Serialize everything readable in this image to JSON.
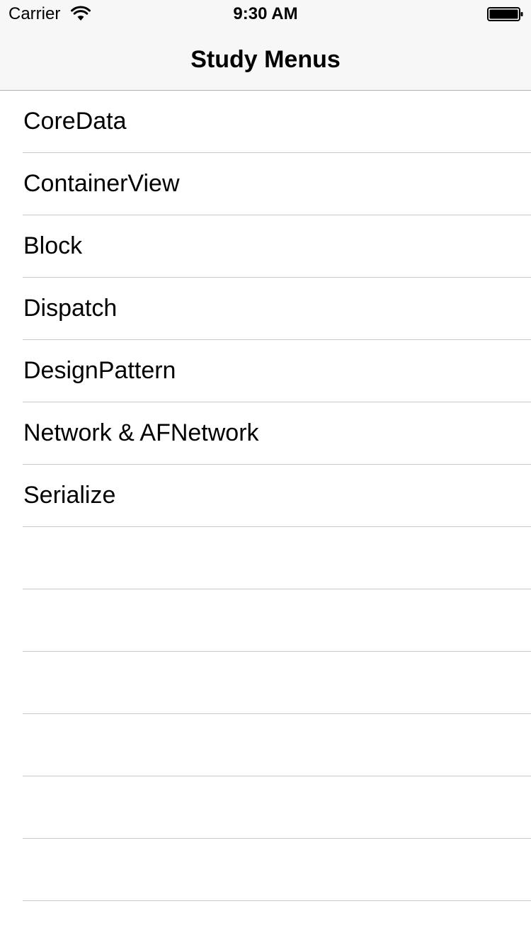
{
  "status_bar": {
    "carrier": "Carrier",
    "time": "9:30 AM",
    "wifi_icon": "wifi-icon",
    "battery_icon": "battery-icon"
  },
  "nav": {
    "title": "Study Menus"
  },
  "menu": {
    "items": [
      {
        "label": "CoreData"
      },
      {
        "label": "ContainerView"
      },
      {
        "label": "Block"
      },
      {
        "label": "Dispatch"
      },
      {
        "label": "DesignPattern"
      },
      {
        "label": "Network & AFNetwork"
      },
      {
        "label": "Serialize"
      }
    ],
    "empty_rows": 6
  },
  "colors": {
    "nav_background": "#f7f7f7",
    "separator": "#c8c7cc",
    "text": "#000000"
  }
}
